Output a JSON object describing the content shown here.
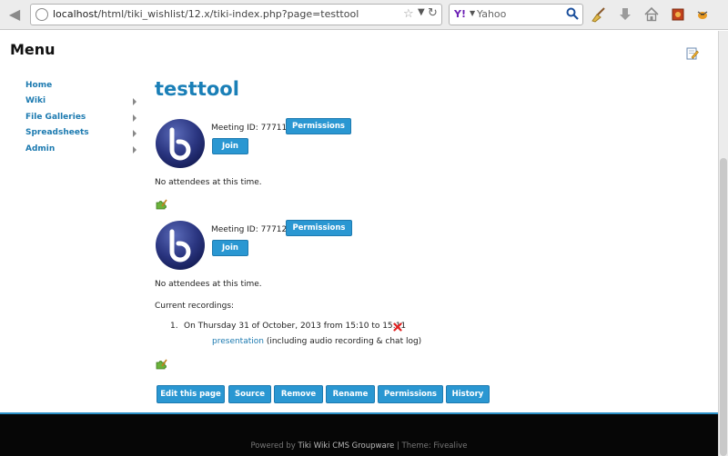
{
  "browser": {
    "url_host": "localhost",
    "url_path": "/html/tiki_wishlist/12.x/tiki-index.php?page=testtool",
    "search_engine": "Y!",
    "search_placeholder": "Yahoo"
  },
  "menu": {
    "title": "Menu",
    "items": [
      {
        "label": "Home",
        "has_submenu": false
      },
      {
        "label": "Wiki",
        "has_submenu": true
      },
      {
        "label": "File Galleries",
        "has_submenu": true
      },
      {
        "label": "Spreadsheets",
        "has_submenu": true
      },
      {
        "label": "Admin",
        "has_submenu": true
      }
    ]
  },
  "page": {
    "title": "testtool",
    "meetings": [
      {
        "meeting_id_label": "Meeting ID: 77711",
        "permissions_label": "Permissions",
        "join_label": "Join",
        "attendees_text": "No attendees at this time."
      },
      {
        "meeting_id_label": "Meeting ID: 77712",
        "permissions_label": "Permissions",
        "join_label": "Join",
        "attendees_text": "No attendees at this time."
      }
    ],
    "recordings": {
      "heading": "Current recordings:",
      "items": [
        {
          "number": "1.",
          "text": "On Thursday 31 of October, 2013 from 15:10 to 15:11",
          "link_text": "presentation",
          "link_note": "(including audio recording & chat log)"
        }
      ]
    },
    "actions": [
      "Edit this page",
      "Source",
      "Remove",
      "Rename",
      "Permissions",
      "History"
    ]
  },
  "footer": {
    "powered_by": "Powered by",
    "cms_name": "Tiki Wiki CMS Groupware",
    "separator": " | Theme: ",
    "theme_name": "Fivealive"
  },
  "colors": {
    "accent": "#2a97d2",
    "link": "#1c7ab0",
    "title": "#1a7fb7",
    "footer_bg": "#060606"
  }
}
